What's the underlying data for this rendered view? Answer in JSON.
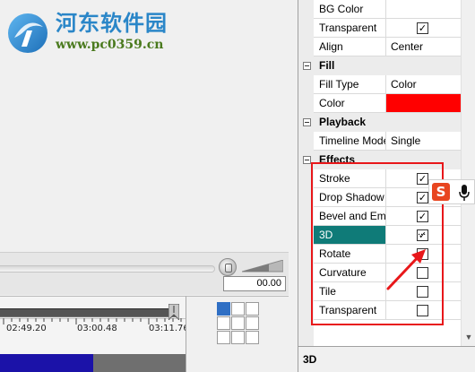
{
  "watermark": {
    "title": "河东软件园",
    "url": "www.pc0359.cn"
  },
  "player": {
    "time_display": "00.00"
  },
  "timeline": {
    "ruler_labels": [
      "02:49.20",
      "03:00.48",
      "03:11.76"
    ]
  },
  "properties": {
    "rows": [
      {
        "name": "BG Color",
        "value": ""
      },
      {
        "name": "Transparent",
        "value": "☑"
      },
      {
        "name": "Align",
        "value": "Center"
      }
    ],
    "fill": {
      "category": "Fill",
      "rows": [
        {
          "name": "Fill Type",
          "value": "Color"
        },
        {
          "name": "Color",
          "value": "",
          "color": "#ff0000"
        }
      ]
    },
    "playback": {
      "category": "Playback",
      "rows": [
        {
          "name": "Timeline Mode",
          "value": "Single"
        }
      ]
    },
    "effects": {
      "category": "Effects",
      "rows": [
        {
          "name": "Stroke",
          "checked": true
        },
        {
          "name": "Drop Shadow",
          "checked": true
        },
        {
          "name": "Bevel and Emboss",
          "checked": true
        },
        {
          "name": "3D",
          "checked": true,
          "selected": true
        },
        {
          "name": "Rotate",
          "checked": true
        },
        {
          "name": "Curvature",
          "checked": false
        },
        {
          "name": "Tile",
          "checked": false
        },
        {
          "name": "Transparent",
          "checked": false
        }
      ],
      "ellipsis": "..."
    },
    "check_mark": "✓"
  },
  "description": {
    "title": "3D"
  },
  "ime": {
    "label": "S"
  },
  "colors": {
    "selection": "#0f7b78",
    "highlight": "#e8171a",
    "clip": "#1b12a8"
  }
}
